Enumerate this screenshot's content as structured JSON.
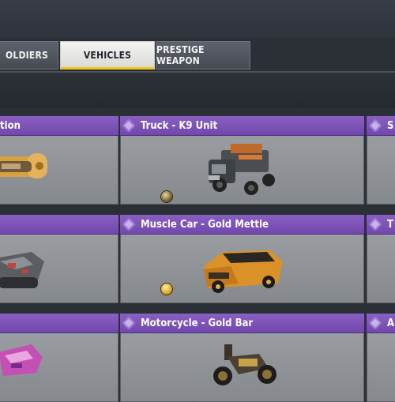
{
  "tabs": [
    {
      "label": "OLDIERS",
      "active": false
    },
    {
      "label": "VEHICLES",
      "active": true
    },
    {
      "label": "PRESTIGE WEAPON",
      "active": false
    }
  ],
  "cards": [
    {
      "title": "tion",
      "clipped": "left"
    },
    {
      "title": "Truck - K9 Unit",
      "clipped": "none"
    },
    {
      "title": "S",
      "clipped": "right"
    },
    {
      "title": "",
      "clipped": "left"
    },
    {
      "title": "Muscle Car - Gold Mettle",
      "clipped": "none"
    },
    {
      "title": "T",
      "clipped": "right"
    },
    {
      "title": "",
      "clipped": "left"
    },
    {
      "title": "Motorcycle - Gold Bar",
      "clipped": "none"
    },
    {
      "title": "A",
      "clipped": "right"
    }
  ],
  "colors": {
    "accent": "#f0c51c",
    "card_header": "#7d52b8",
    "card_body": "#92969a",
    "background": "#2b2f36"
  }
}
